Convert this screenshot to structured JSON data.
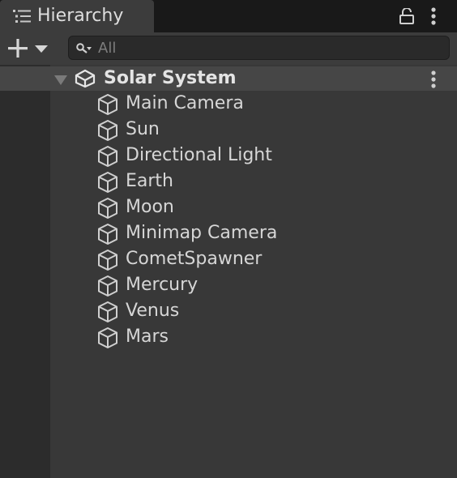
{
  "panel": {
    "title": "Hierarchy",
    "icons": [
      "list-icon",
      "lock-icon",
      "kebab-menu-icon"
    ]
  },
  "toolbar": {
    "add_icon": "plus-with-dropdown-icon",
    "search": {
      "placeholder": "All",
      "value": ""
    }
  },
  "scene": {
    "name": "Solar System",
    "expanded": true,
    "icon": "unity-logo-icon"
  },
  "objects": [
    {
      "label": "Main Camera",
      "icon": "cube-icon"
    },
    {
      "label": "Sun",
      "icon": "cube-icon"
    },
    {
      "label": "Directional Light",
      "icon": "cube-icon"
    },
    {
      "label": "Earth",
      "icon": "cube-icon"
    },
    {
      "label": "Moon",
      "icon": "cube-icon"
    },
    {
      "label": "Minimap Camera",
      "icon": "cube-icon"
    },
    {
      "label": "CometSpawner",
      "icon": "cube-icon"
    },
    {
      "label": "Mercury",
      "icon": "cube-icon"
    },
    {
      "label": "Venus",
      "icon": "cube-icon"
    },
    {
      "label": "Mars",
      "icon": "cube-icon"
    }
  ],
  "colors": {
    "panel_bg": "#383838",
    "tab_bg": "#3c3c3c",
    "scene_row_bg": "#464646",
    "text": "#d2d2d2"
  }
}
